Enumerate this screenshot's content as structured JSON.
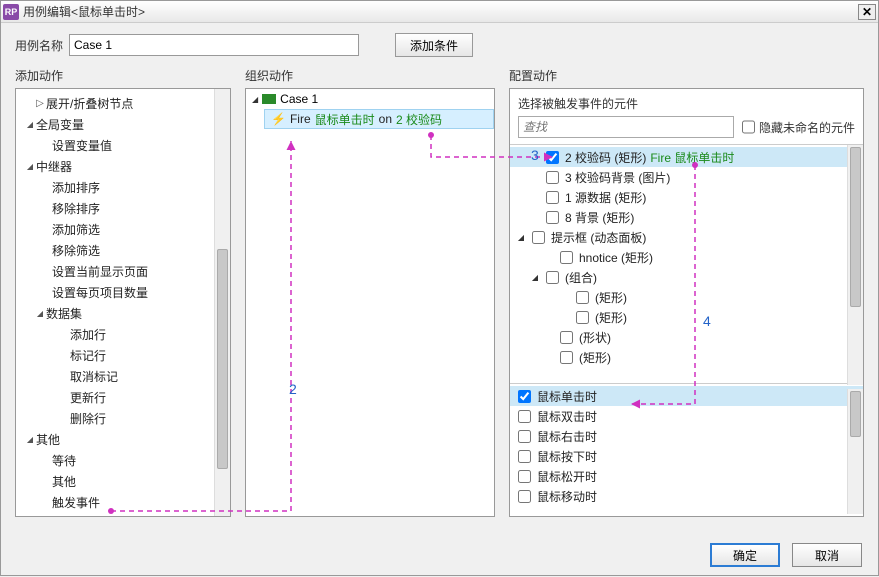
{
  "titlebar": {
    "icon": "RP",
    "title": "用例编辑<鼠标单击时>"
  },
  "top": {
    "name_label": "用例名称",
    "name_value": "Case 1",
    "add_cond": "添加条件"
  },
  "columns": {
    "c1": "添加动作",
    "c2": "组织动作",
    "c3": "配置动作"
  },
  "add_actions": {
    "expand": "展开/折叠树节点",
    "globals": "全局变量",
    "set_var": "设置变量值",
    "repeater": "中继器",
    "r_items": [
      "添加排序",
      "移除排序",
      "添加筛选",
      "移除筛选",
      "设置当前显示页面",
      "设置每页项目数量"
    ],
    "dataset": "数据集",
    "d_items": [
      "添加行",
      "标记行",
      "取消标记",
      "更新行",
      "删除行"
    ],
    "other": "其他",
    "o_items": [
      "等待",
      "其他",
      "触发事件"
    ]
  },
  "org": {
    "case": "Case 1",
    "fire": "Fire",
    "event": "鼠标单击时",
    "on": "on",
    "target": "2 校验码"
  },
  "cfg": {
    "header": "选择被触发事件的元件",
    "search_placeholder": "查找",
    "hide_unnamed": "隐藏未命名的元件",
    "widgets": [
      {
        "pad": 1,
        "arrow": "",
        "checked": true,
        "sel": true,
        "label": "2 校验码 (矩形)",
        "extra": "Fire 鼠标单击时"
      },
      {
        "pad": 1,
        "arrow": "",
        "checked": false,
        "label": "3 校验码背景 (图片)"
      },
      {
        "pad": 1,
        "arrow": "",
        "checked": false,
        "label": "1 源数据 (矩形)"
      },
      {
        "pad": 1,
        "arrow": "",
        "checked": false,
        "label": "8 背景 (矩形)"
      },
      {
        "pad": 0,
        "arrow": "◢",
        "checked": false,
        "label": "提示框 (动态面板)"
      },
      {
        "pad": 2,
        "arrow": "",
        "checked": false,
        "label": "hnotice (矩形)"
      },
      {
        "pad": 1,
        "arrow": "◢",
        "checked": false,
        "label": "(组合)"
      },
      {
        "pad": 3,
        "arrow": "",
        "checked": false,
        "label": "(矩形)"
      },
      {
        "pad": 3,
        "arrow": "",
        "checked": false,
        "label": "(矩形)"
      },
      {
        "pad": 2,
        "arrow": "",
        "checked": false,
        "label": "(形状)"
      },
      {
        "pad": 2,
        "arrow": "",
        "checked": false,
        "label": "(矩形)"
      }
    ],
    "events": [
      {
        "checked": true,
        "sel": true,
        "label": "鼠标单击时"
      },
      {
        "checked": false,
        "label": "鼠标双击时"
      },
      {
        "checked": false,
        "label": "鼠标右击时"
      },
      {
        "checked": false,
        "label": "鼠标按下时"
      },
      {
        "checked": false,
        "label": "鼠标松开时"
      },
      {
        "checked": false,
        "label": "鼠标移动时"
      }
    ]
  },
  "footer": {
    "ok": "确定",
    "cancel": "取消"
  },
  "annotations": {
    "n2": "2",
    "n3": "3",
    "n4": "4"
  }
}
